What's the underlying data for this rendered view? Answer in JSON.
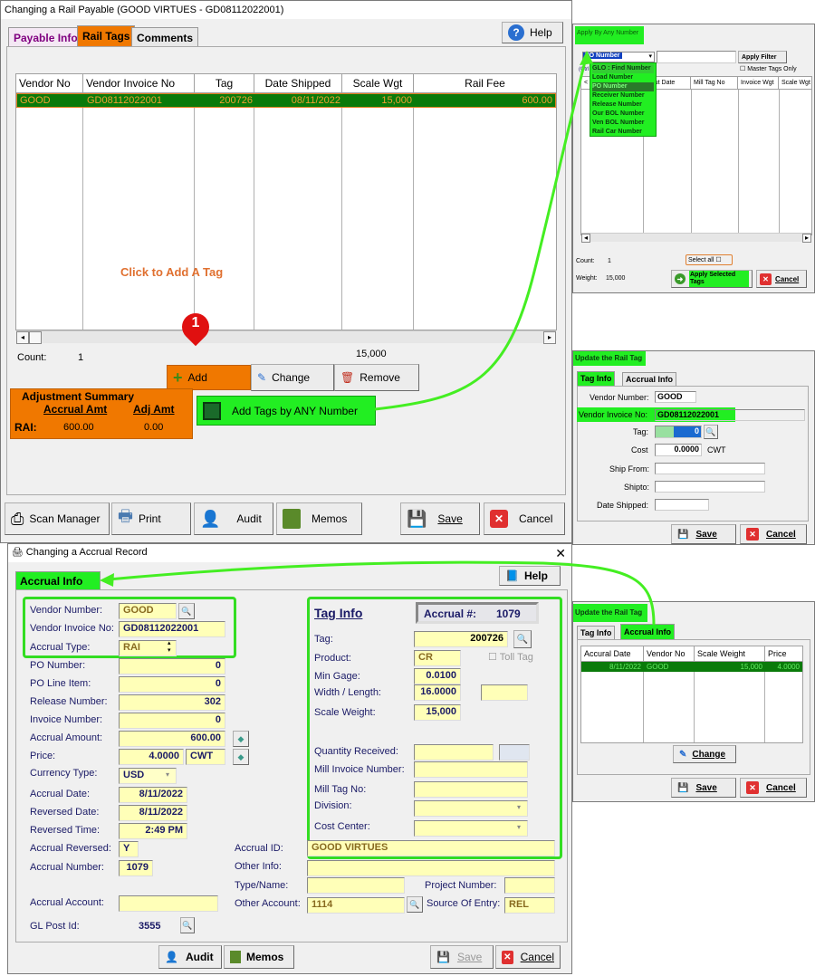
{
  "rail_payable": {
    "title": "Changing a Rail Payable  (GOOD VIRTUES - GD08112022001)",
    "tabs": [
      "Payable Info",
      "Rail Tags",
      "Comments"
    ],
    "help_label": "Help",
    "grid_headers": [
      "Vendor No",
      "Vendor Invoice No",
      "Tag",
      "Date Shipped",
      "Scale Wgt",
      "Rail Fee"
    ],
    "grid_rows": [
      {
        "vendor_no": "GOOD",
        "vendor_invoice_no": "GD08112022001",
        "tag": "200726",
        "date_shipped": "08/11/2022",
        "scale_wgt": "15,000",
        "rail_fee": "600.00"
      }
    ],
    "click_hint": "Click to Add A Tag",
    "count_label": "Count:",
    "count_value": "1",
    "weight_total": "15,000",
    "add_label": "Add",
    "change_label": "Change",
    "remove_label": "Remove",
    "step_marker": "1",
    "adjustment": {
      "title": "Adjustment Summary",
      "col1": "Accrual Amt",
      "col2": "Adj Amt",
      "row_label": "RAI:",
      "accrual_amt": "600.00",
      "adj_amt": "0.00"
    },
    "add_tags_any_label": "Add Tags by ANY Number",
    "bottom_buttons": [
      "Scan Manager",
      "Print",
      "Audit",
      "Memos",
      "Save",
      "Cancel"
    ]
  },
  "apply_any": {
    "title": "Apply By Any Number",
    "select_value": "PO Number",
    "apply_filter_label": "Apply Filter",
    "hint": "(Ctrl click to multi select)",
    "master_tags_label": "Master Tags Only",
    "dropdown_options": [
      "GLO : Find Number",
      "Load Number",
      "PO Number",
      "Receiver Number",
      "Release Number",
      "Our BOL Number",
      "Ven BOL Number",
      "Rail Car Number"
    ],
    "selected_option": "PO Number",
    "grid_headers": [
      "<",
      "Input Date",
      "Mill Tag No",
      "Invoice Wgt",
      "Scale Wgt"
    ],
    "count_label": "Count:",
    "count_value": "1",
    "weight_label": "Weight:",
    "weight_value": "15,000",
    "select_all_label": "Select all",
    "apply_selected_label": "Apply Selected Tags",
    "cancel_label": "Cancel"
  },
  "update_tag_1": {
    "title": "Update the Rail Tag",
    "tabs": [
      "Tag Info",
      "Accrual Info"
    ],
    "vendor_number_label": "Vendor Number:",
    "vendor_number": "GOOD",
    "vendor_invoice_label": "Vendor Invoice No:",
    "vendor_invoice": "GD08112022001",
    "tag_label": "Tag:",
    "tag_value": "0",
    "cost_label": "Cost",
    "cost_value": "0.0000",
    "cost_unit": "CWT",
    "ship_from_label": "Ship From:",
    "ship_to_label": "Shipto:",
    "date_shipped_label": "Date Shipped:",
    "save_label": "Save",
    "cancel_label": "Cancel"
  },
  "update_tag_2": {
    "title": "Update the Rail Tag",
    "tabs": [
      "Tag Info",
      "Accrual Info"
    ],
    "grid_headers": [
      "Accural Date",
      "Vendor No",
      "Scale Weight",
      "Price"
    ],
    "grid_rows": [
      {
        "date": "8/11/2022",
        "vendor": "GOOD",
        "weight": "15,000",
        "price": "4.0000"
      }
    ],
    "change_label": "Change",
    "save_label": "Save",
    "cancel_label": "Cancel"
  },
  "accrual": {
    "title": "Changing a Accrual Record",
    "tab": "Accrual Info",
    "help_label": "Help",
    "left_fields": [
      {
        "label": "Vendor Number:",
        "value": "GOOD"
      },
      {
        "label": "Vendor Invoice No:",
        "value": "GD08112022001"
      },
      {
        "label": "Accrual Type:",
        "value": "RAI"
      },
      {
        "label": "PO Number:",
        "value": "0"
      },
      {
        "label": "PO Line Item:",
        "value": "0"
      },
      {
        "label": "Release Number:",
        "value": "302"
      },
      {
        "label": "Invoice Number:",
        "value": "0"
      },
      {
        "label": "Accrual Amount:",
        "value": "600.00"
      },
      {
        "label": "Price:",
        "value": "4.0000"
      },
      {
        "label": "Currency Type:",
        "value": "USD"
      },
      {
        "label": "Accrual Date:",
        "value": "8/11/2022"
      },
      {
        "label": "Reversed Date:",
        "value": "8/11/2022"
      },
      {
        "label": "Reversed Time:",
        "value": "2:49 PM"
      },
      {
        "label": "Accrual Reversed:",
        "value": "Y"
      },
      {
        "label": "Accrual Number:",
        "value": "1079"
      },
      {
        "label": "Accrual Account:",
        "value": ""
      },
      {
        "label": "GL Post Id:",
        "value": "3555"
      }
    ],
    "price_unit": "CWT",
    "tag_info": {
      "title": "Tag Info",
      "accrual_no_label": "Accrual #:",
      "accrual_no": "1079",
      "tag_label": "Tag:",
      "tag": "200726",
      "product_label": "Product:",
      "product": "CR",
      "toll_tag_label": "Toll Tag",
      "min_gage_label": "Min Gage:",
      "min_gage": "0.0100",
      "width_label": "Width / Length:",
      "width": "16.0000",
      "length": "",
      "scale_weight_label": "Scale Weight:",
      "scale_weight": "15,000",
      "qty_received_label": "Quantity Received:",
      "qty_received": "",
      "mill_invoice_label": "Mill Invoice Number:",
      "mill_invoice": "",
      "mill_tag_label": "Mill Tag No:",
      "mill_tag": "",
      "division_label": "Division:",
      "division": "",
      "cost_center_label": "Cost Center:",
      "cost_center": ""
    },
    "accrual_id_label": "Accrual ID:",
    "accrual_id": "GOOD VIRTUES",
    "other_info_label": "Other Info:",
    "other_info": "",
    "type_name_label": "Type/Name:",
    "type_name": "",
    "project_number_label": "Project Number:",
    "project_number": "",
    "other_account_label": "Other Account:",
    "other_account": "1114",
    "source_label": "Source Of Entry:",
    "source": "REL",
    "buttons": [
      "Audit",
      "Memos",
      "Save",
      "Cancel"
    ]
  },
  "colors": {
    "highlight_green": "#22ee22",
    "orange": "#f07800",
    "row_green": "#0a7a0a",
    "field_yellow": "#ffffb8"
  }
}
